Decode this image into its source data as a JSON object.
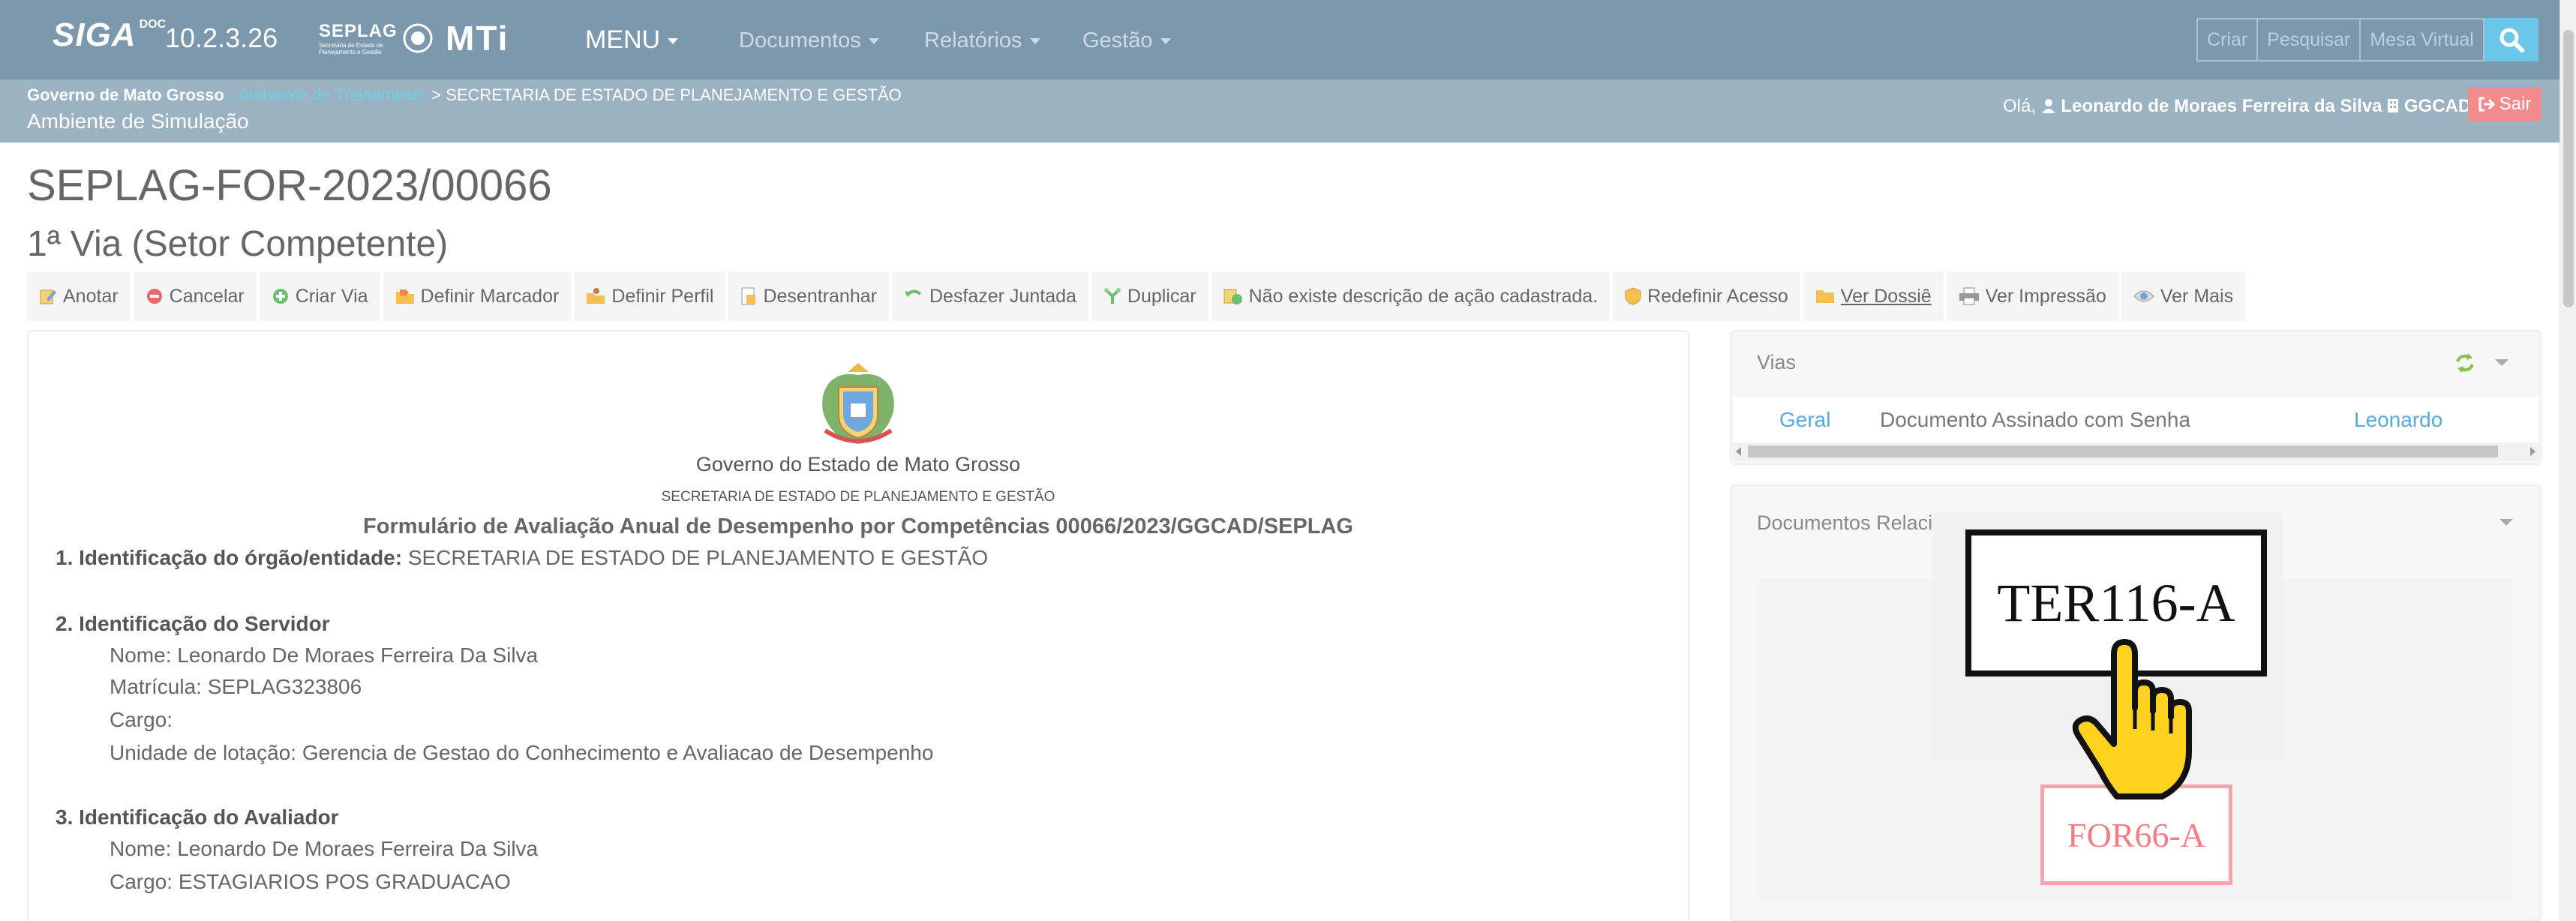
{
  "navbar": {
    "brand": "SIGA",
    "brand_sup": "DOC",
    "version": "10.2.3.26",
    "seplag_logo": "SEPLAG",
    "seplag_logo_sub1": "Secretaria de Estado de",
    "seplag_logo_sub2": "Planejamento e Gestão",
    "mti_logo": "MTi",
    "menu": "MENU",
    "items": [
      "Documentos",
      "Relatórios",
      "Gestão"
    ],
    "buttons": [
      "Criar",
      "Pesquisar",
      "Mesa Virtual"
    ],
    "search_icon": "search-icon"
  },
  "subbar": {
    "org": "Governo de Mato Grosso",
    "env_sep": " - ",
    "env": "Ambiente de Treinamento",
    "arrow": " > ",
    "secretaria": "SECRETARIA DE ESTADO DE PLANEJAMENTO E GESTÃO",
    "env_title": "Ambiente de Simulação",
    "greet_prefix": "Olá, ",
    "user": "Leonardo de Moraes Ferreira da Silva",
    "unit": "GGCAD",
    "logout": "Sair"
  },
  "document": {
    "code": "SEPLAG-FOR-2023/00066",
    "via": "1ª Via (Setor Competente)"
  },
  "toolbar": [
    {
      "label": "Anotar",
      "icon": "note-edit-icon"
    },
    {
      "label": "Cancelar",
      "icon": "cancel-icon"
    },
    {
      "label": "Criar Via",
      "icon": "add-icon"
    },
    {
      "label": "Definir Marcador",
      "icon": "folder-tag-icon"
    },
    {
      "label": "Definir Perfil",
      "icon": "profile-icon"
    },
    {
      "label": "Desentranhar",
      "icon": "document-icon"
    },
    {
      "label": "Desfazer Juntada",
      "icon": "undo-icon"
    },
    {
      "label": "Duplicar",
      "icon": "duplicate-icon"
    },
    {
      "label": "Não existe descrição de ação cadastrada.",
      "icon": "action-icon"
    },
    {
      "label": "Redefinir Acesso",
      "icon": "shield-icon"
    },
    {
      "label": "Ver Dossiê",
      "icon": "folder-icon"
    },
    {
      "label": "Ver Impressão",
      "icon": "printer-icon"
    },
    {
      "label": "Ver Mais",
      "icon": "eye-icon"
    }
  ],
  "form": {
    "gov": "Governo do Estado de Mato Grosso",
    "secretaria": "SECRETARIA DE ESTADO DE PLANEJAMENTO E GESTÃO",
    "title": "Formulário de Avaliação Anual de Desempenho por Competências 00066/2023/GGCAD/SEPLAG",
    "s1_label": "1. Identificação do órgão/entidade:",
    "s1_value": " SECRETARIA DE ESTADO DE PLANEJAMENTO E GESTÃO",
    "s2_label": "2. Identificação do Servidor",
    "s2_nome": "Nome: Leonardo De Moraes Ferreira Da Silva",
    "s2_matricula": "Matrícula: SEPLAG323806",
    "s2_cargo": "Cargo:",
    "s2_unidade": "Unidade de lotação: Gerencia de Gestao do Conhecimento e Avaliacao de Desempenho",
    "s3_label": "3. Identificação do Avaliador",
    "s3_nome": "Nome: Leonardo De Moraes Ferreira Da Silva",
    "s3_cargo": "Cargo: ESTAGIARIOS POS GRADUACAO"
  },
  "vias": {
    "title": "Vias",
    "row": [
      "Geral",
      "Documento Assinado com Senha",
      "Leonardo"
    ]
  },
  "related": {
    "title": "Documentos Relacionados",
    "node_main": "TER116-A",
    "node_child": "FOR66-A"
  },
  "colors": {
    "navbar": "#7c98ad",
    "subbar": "#9bb2c3",
    "link": "#56aadd",
    "logout": "#f28c8c",
    "search": "#6cc6e8"
  }
}
